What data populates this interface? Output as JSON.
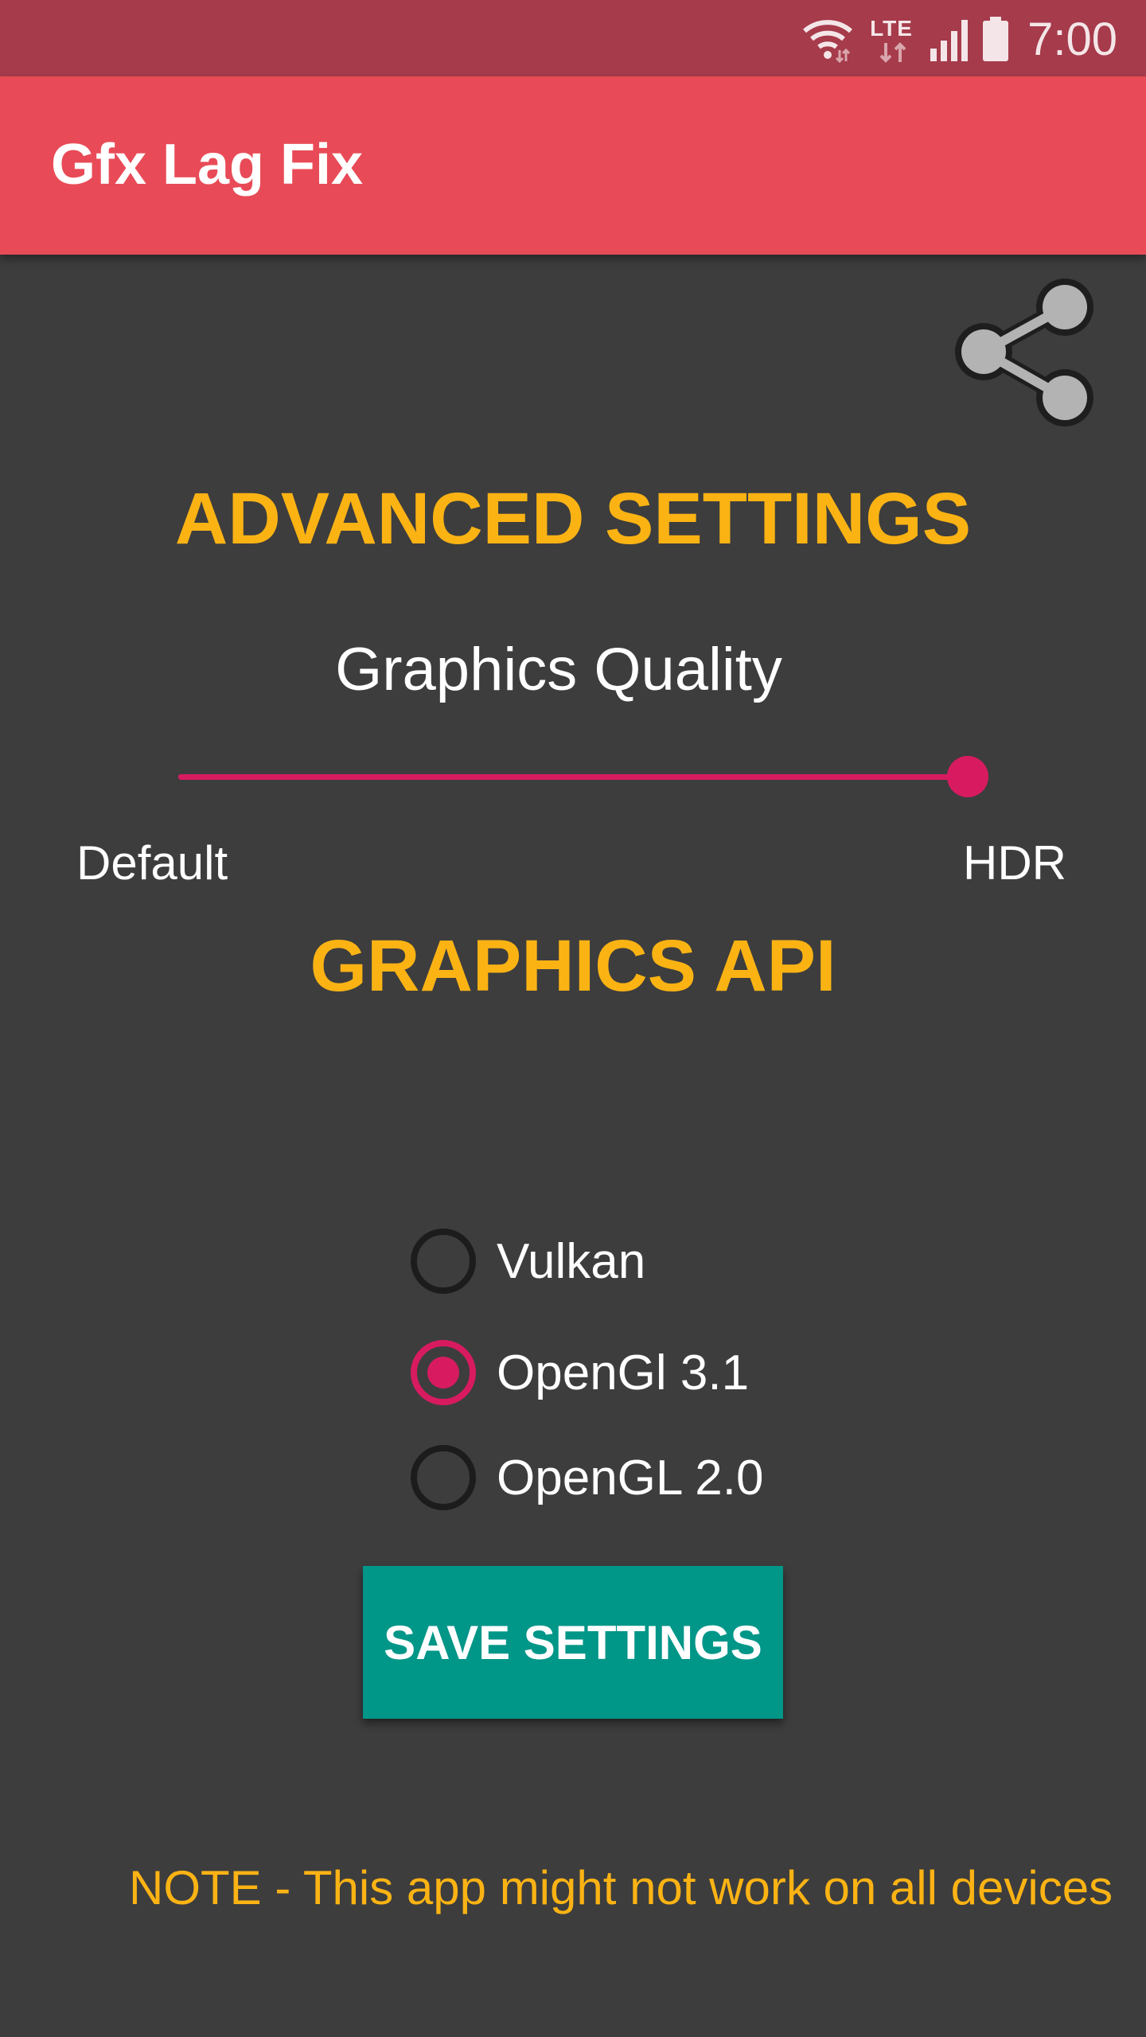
{
  "status_bar": {
    "time": "7:00",
    "network_label": "LTE",
    "icons": [
      "wifi-icon",
      "lte-icon",
      "cell-signal-icon",
      "battery-icon"
    ],
    "color": "#a63b4b"
  },
  "app_bar": {
    "title": "Gfx Lag Fix",
    "color": "#e84b57"
  },
  "share": {
    "icon": "share-icon"
  },
  "advanced": {
    "heading": "ADVANCED SETTINGS"
  },
  "quality": {
    "label": "Graphics Quality",
    "slider_value": 1.0,
    "min_label": "Default",
    "max_label": "HDR",
    "accent": "#d81b60"
  },
  "api": {
    "heading": "GRAPHICS API",
    "options": [
      {
        "label": "Vulkan",
        "checked": false
      },
      {
        "label": "OpenGl 3.1",
        "checked": true
      },
      {
        "label": "OpenGL 2.0",
        "checked": false
      }
    ]
  },
  "save_button": {
    "label": "SAVE SETTINGS",
    "color": "#009688"
  },
  "note": "NOTE - This app might not work on all devices",
  "colors": {
    "background": "#3d3d3d",
    "heading": "#fbb314"
  }
}
